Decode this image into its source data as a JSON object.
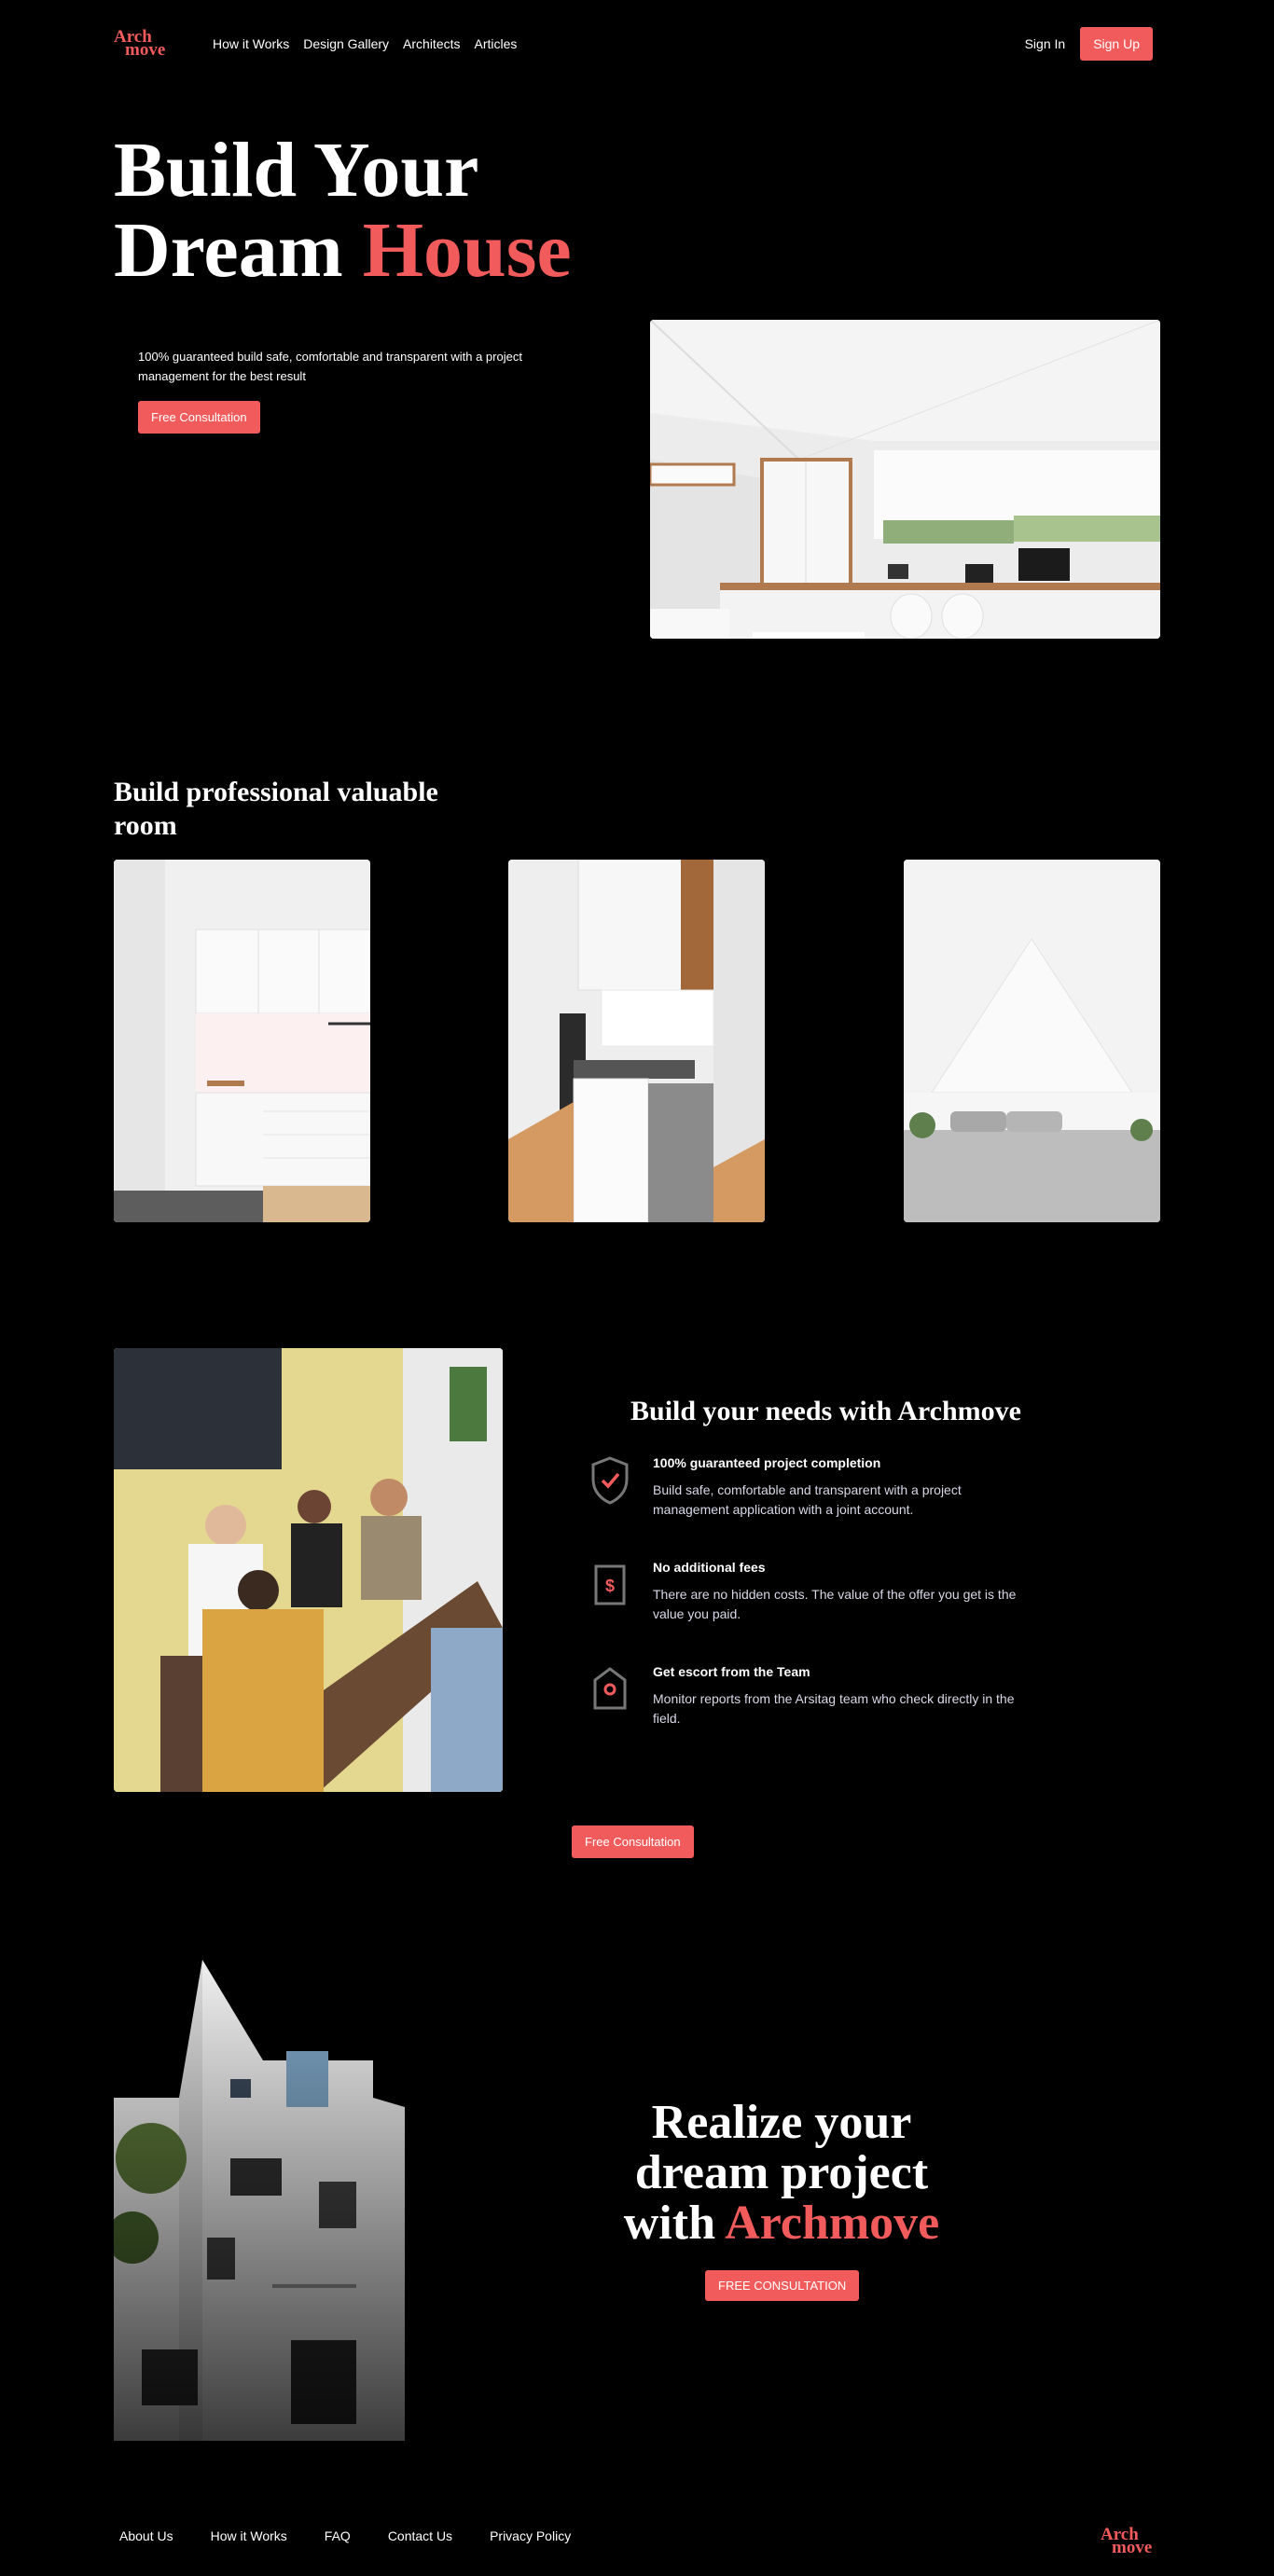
{
  "brand": {
    "logo_line1": "Arch",
    "logo_line2": "move",
    "accent_color": "#f15b5b"
  },
  "nav": {
    "links": [
      "How it Works",
      "Design Gallery",
      "Architects",
      "Articles"
    ],
    "sign_in": "Sign In",
    "sign_up": "Sign Up"
  },
  "hero": {
    "title_line1": "Build Your",
    "title_line2_plain": "Dream",
    "title_line2_accent": "House",
    "description": "100% guaranteed build safe, comfortable and transparent with a project management for the best result",
    "cta": "Free Consultation"
  },
  "rooms": {
    "title": "Build professional valuable room"
  },
  "needs": {
    "title": "Build your needs with Archmove",
    "features": [
      {
        "icon": "shield-check-icon",
        "title": "100% guaranteed project completion",
        "text": "Build safe, comfortable and transparent with a project management application with a joint account."
      },
      {
        "icon": "dollar-document-icon",
        "title": "No additional fees",
        "text": "There are no hidden costs. The value of the offer you get is the value you paid."
      },
      {
        "icon": "tag-icon",
        "title": "Get escort from the Team",
        "text": "Monitor reports from the Arsitag team who check directly in the field."
      }
    ],
    "cta": "Free Consultation"
  },
  "realize": {
    "line1": "Realize your",
    "line2": "dream project",
    "line3_plain": "with",
    "line3_accent": "Archmove",
    "cta": "FREE CONSULTATION"
  },
  "footer": {
    "links": [
      "About Us",
      "How it Works",
      "FAQ",
      "Contact Us",
      "Privacy Policy"
    ],
    "logo_line1": "Arch",
    "logo_line2": "move"
  }
}
